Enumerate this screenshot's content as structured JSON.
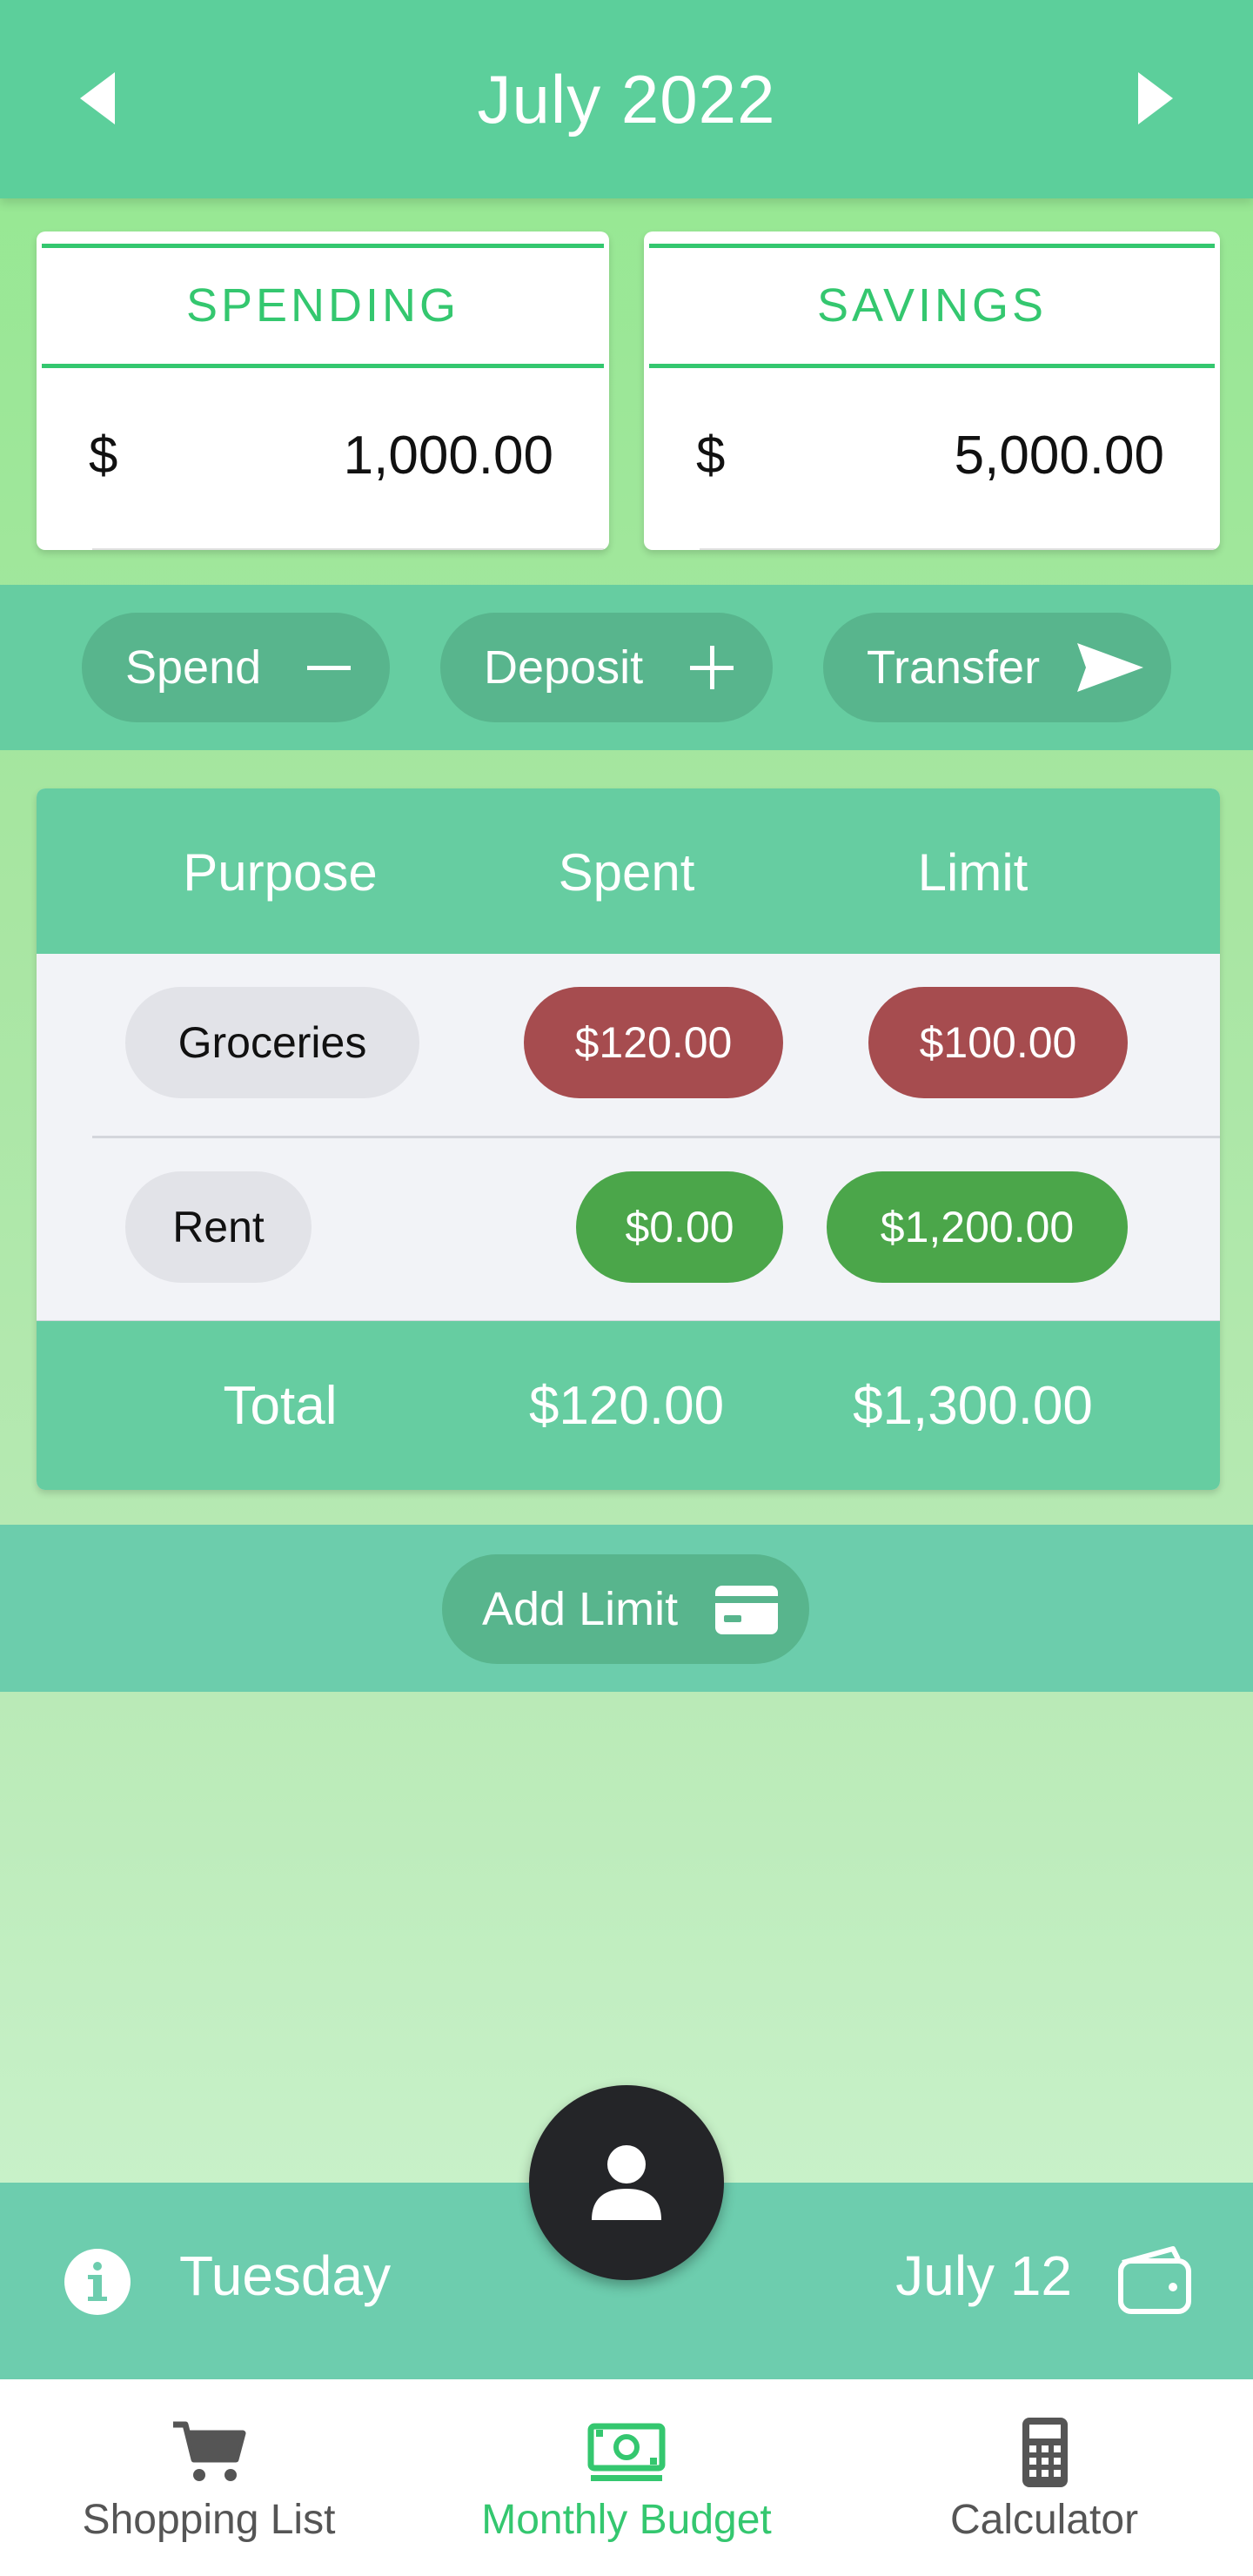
{
  "header": {
    "title": "July 2022"
  },
  "cards": {
    "spending": {
      "label": "SPENDING",
      "currency": "$",
      "amount": "1,000.00"
    },
    "savings": {
      "label": "SAVINGS",
      "currency": "$",
      "amount": "5,000.00"
    }
  },
  "actions": {
    "spend": "Spend",
    "deposit": "Deposit",
    "transfer": "Transfer"
  },
  "table": {
    "headers": [
      "Purpose",
      "Spent",
      "Limit"
    ],
    "rows": [
      {
        "purpose": "Groceries",
        "spent": "$120.00",
        "limit": "$100.00"
      },
      {
        "purpose": "Rent",
        "spent": "$0.00",
        "limit": "$1,200.00"
      }
    ],
    "footer": {
      "label": "Total",
      "spent": "$120.00",
      "limit": "$1,300.00"
    }
  },
  "add_limit": "Add Limit",
  "info_bar": {
    "day": "Tuesday",
    "date": "July 12"
  },
  "bottom_nav": [
    {
      "label": "Shopping List",
      "icon": "cart-icon"
    },
    {
      "label": "Monthly Budget",
      "icon": "money-icon",
      "active": true
    },
    {
      "label": "Calculator",
      "icon": "calculator-icon"
    }
  ],
  "colors": {
    "accent": "#34c76f",
    "header": "#5ccf9b",
    "over_limit": "#a64c4f",
    "under_limit": "#4ba64a"
  }
}
